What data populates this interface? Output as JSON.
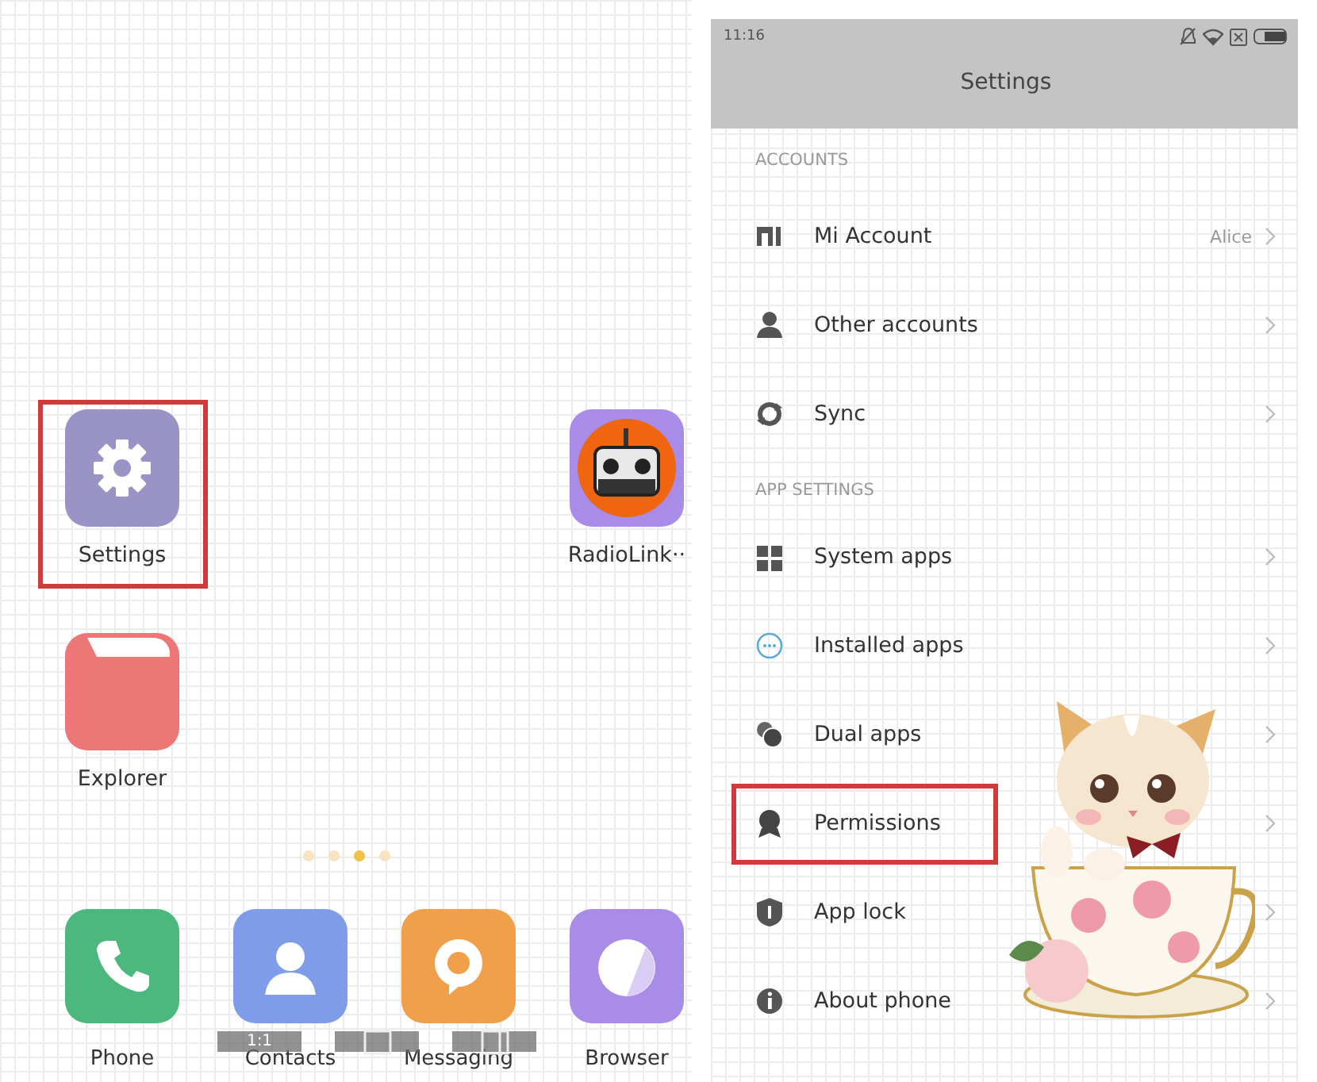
{
  "home_screen": {
    "app_rows": [
      [
        {
          "label": "Settings",
          "color": "#9a94c6",
          "highlighted": true
        },
        null,
        null,
        {
          "label": "RadioLink··",
          "color": "#a98ce8",
          "highlighted": false
        }
      ],
      [
        {
          "label": "Explorer",
          "color": "#ec7776",
          "highlighted": false
        }
      ]
    ],
    "page_dots": [
      {
        "selected": false
      },
      {
        "selected": false
      },
      {
        "selected": true
      },
      {
        "selected": false
      }
    ],
    "dock": [
      {
        "label": "Phone",
        "color": "#4cb87d"
      },
      {
        "label": "Contacts",
        "color": "#7f9ce9"
      },
      {
        "label": "Messaging",
        "color": "#f0a04a"
      },
      {
        "label": "Browser",
        "color": "#a98ce8"
      }
    ],
    "overlay_toolbar": [
      {
        "kind": "ratio",
        "label": "1:1"
      },
      {
        "kind": "frame"
      },
      {
        "kind": "split"
      }
    ]
  },
  "settings_screen": {
    "status_bar": {
      "time": "11:16"
    },
    "title": "Settings",
    "sections": [
      {
        "header": "ACCOUNTS",
        "items": [
          {
            "label": "Mi Account",
            "value": "Alice",
            "highlighted": false
          },
          {
            "label": "Other accounts",
            "highlighted": false
          },
          {
            "label": "Sync",
            "highlighted": false
          }
        ]
      },
      {
        "header": "APP SETTINGS",
        "items": [
          {
            "label": "System apps",
            "highlighted": false
          },
          {
            "label": "Installed apps",
            "highlighted": false
          },
          {
            "label": "Dual apps",
            "highlighted": false
          },
          {
            "label": "Permissions",
            "highlighted": true
          },
          {
            "label": "App lock",
            "highlighted": false
          },
          {
            "label": "About phone",
            "highlighted": false
          }
        ]
      }
    ]
  }
}
